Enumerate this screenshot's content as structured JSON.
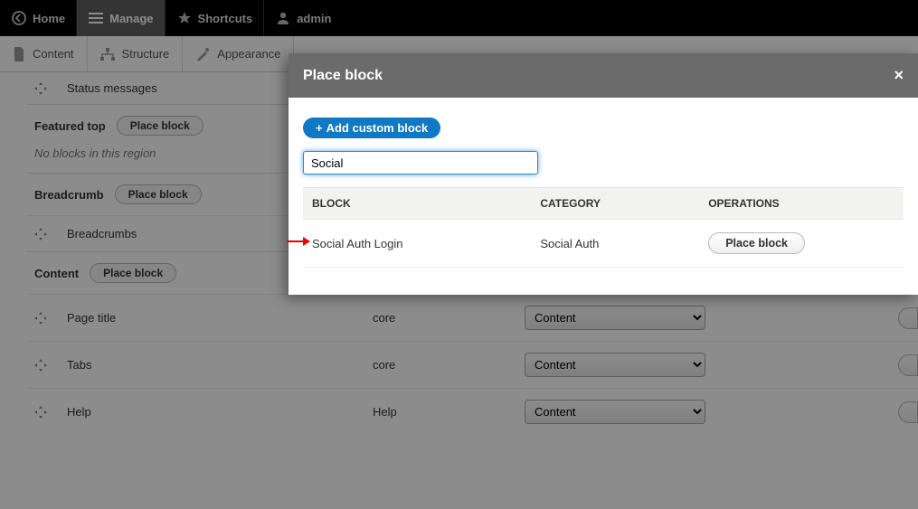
{
  "topbar": {
    "home": "Home",
    "manage": "Manage",
    "shortcuts": "Shortcuts",
    "admin": "admin"
  },
  "tabs": {
    "content": "Content",
    "structure": "Structure",
    "appearance": "Appearance"
  },
  "page": {
    "status_messages": "Status messages",
    "featured_top": "Featured top",
    "featured_top_empty": "No blocks in this region",
    "breadcrumb": "Breadcrumb",
    "breadcrumbs": "Breadcrumbs",
    "content": "Content",
    "page_title": "Page title",
    "tabs_block": "Tabs",
    "help_block": "Help",
    "cat_core": "core",
    "cat_help": "Help",
    "region_content": "Content",
    "place_block_label": "Place block"
  },
  "modal": {
    "title": "Place block",
    "add_custom": "Add custom block",
    "filter_value": "Social",
    "col_block": "BLOCK",
    "col_category": "CATEGORY",
    "col_ops": "OPERATIONS",
    "row_block": "Social Auth Login",
    "row_category": "Social Auth",
    "row_op": "Place block",
    "close": "×"
  }
}
